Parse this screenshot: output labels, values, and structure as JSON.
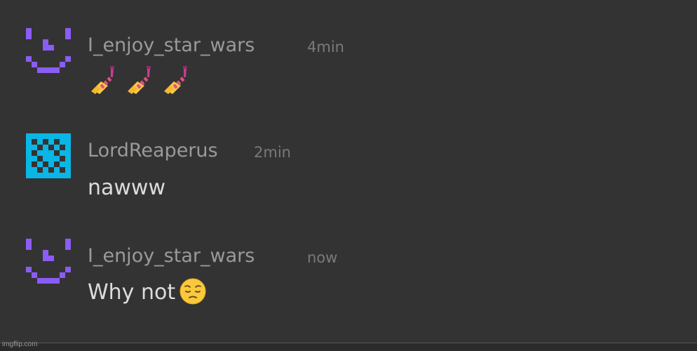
{
  "messages": [
    {
      "username": "I_enjoy_star_wars",
      "time": "4min",
      "avatar_icon": "purple-pixel-face-icon",
      "content_type": "emoji",
      "emojis": [
        "nail-polish-emoji",
        "nail-polish-emoji",
        "nail-polish-emoji"
      ]
    },
    {
      "username": "LordReaperus",
      "time": "2min",
      "avatar_icon": "cyan-checker-pattern-icon",
      "content_type": "text",
      "text": "nawww"
    },
    {
      "username": "I_enjoy_star_wars",
      "time": "now",
      "avatar_icon": "purple-pixel-face-icon",
      "content_type": "text",
      "text": "Why not",
      "trailing_emoji": "pensive-face-emoji"
    }
  ],
  "watermark": "imgflip.com",
  "colors": {
    "background": "#333333",
    "username": "#9a9a9a",
    "timestamp": "#7a7a7a",
    "message_text": "#dcdcdc",
    "purple_avatar": "#8b5cf6",
    "cyan_avatar": "#0ab6e6"
  }
}
